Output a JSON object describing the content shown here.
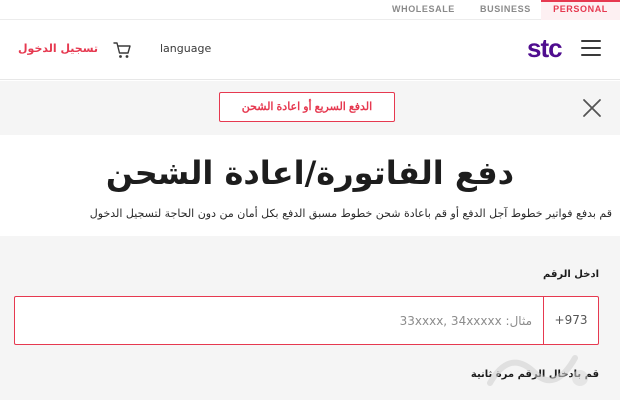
{
  "segments": {
    "wholesale": "WHOLESALE",
    "business": "BUSINESS",
    "personal": "PERSONAL"
  },
  "header": {
    "logo": "stc",
    "language": "language",
    "login": "تسجيل الدخول"
  },
  "banner": {
    "quick_pay": "الدفع السريع أو اعادة الشحن"
  },
  "main": {
    "title": "دفع الفاتورة/اعادة الشحن",
    "subtitle": "قم بدفع فواتير خطوط آجل الدفع أو قم باعادة شحن خطوط مسبق الدفع بكل أمان من دون الحاجة لتسجيل الدخول"
  },
  "form": {
    "number_label": "ادخل الرقم",
    "prefix": "+973",
    "number_placeholder": "مثال: 33xxxx, 34xxxxx",
    "number_value": "",
    "confirm_label": "قم بادخال الرقم مرة ثانية"
  },
  "colors": {
    "accent": "#e63950",
    "brand": "#4f0d8f",
    "panel": "#f5f5f5"
  },
  "icons": {
    "menu": "hamburger-menu-icon",
    "cart": "cart-icon",
    "close": "close-icon"
  }
}
